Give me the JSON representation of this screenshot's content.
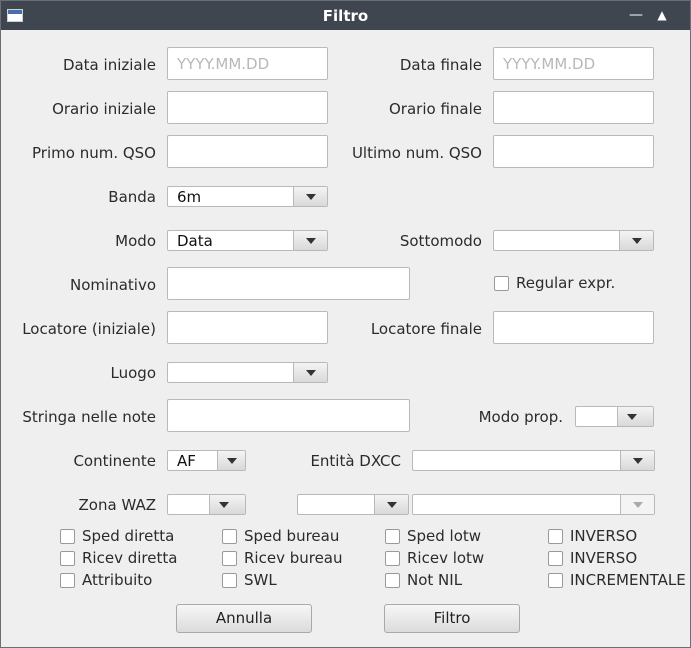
{
  "window": {
    "title": "Filtro"
  },
  "labels": {
    "data_iniziale": "Data iniziale",
    "data_finale": "Data finale",
    "orario_iniziale": "Orario iniziale",
    "orario_finale": "Orario finale",
    "primo_num_qso": "Primo num. QSO",
    "ultimo_num_qso": "Ultimo num. QSO",
    "banda": "Banda",
    "modo": "Modo",
    "sottomodo": "Sottomodo",
    "nominativo": "Nominativo",
    "locatore_iniziale": "Locatore (iniziale)",
    "locatore_finale": "Locatore finale",
    "luogo": "Luogo",
    "stringa_note": "Stringa nelle note",
    "modo_prop": "Modo prop.",
    "continente": "Continente",
    "entita_dxcc": "Entità DXCC",
    "zona_waz": "Zona WAZ"
  },
  "placeholders": {
    "data_iniziale": "YYYY.MM.DD",
    "data_finale": "YYYY.MM.DD"
  },
  "values": {
    "banda": "6m",
    "modo": "Data",
    "continente": "AF"
  },
  "checkboxes": {
    "regular_expr": "Regular expr.",
    "sped_diretta": "Sped diretta",
    "sped_bureau": "Sped bureau",
    "sped_lotw": "Sped lotw",
    "inverso_1": "INVERSO",
    "ricev_diretta": "Ricev diretta",
    "ricev_bureau": "Ricev bureau",
    "ricev_lotw": "Ricev lotw",
    "inverso_2": "INVERSO",
    "attribuito": "Attribuito",
    "swl": "SWL",
    "not_nil": "Not NIL",
    "incrementale": "INCREMENTALE"
  },
  "buttons": {
    "annulla": "Annulla",
    "filtro": "Filtro"
  }
}
